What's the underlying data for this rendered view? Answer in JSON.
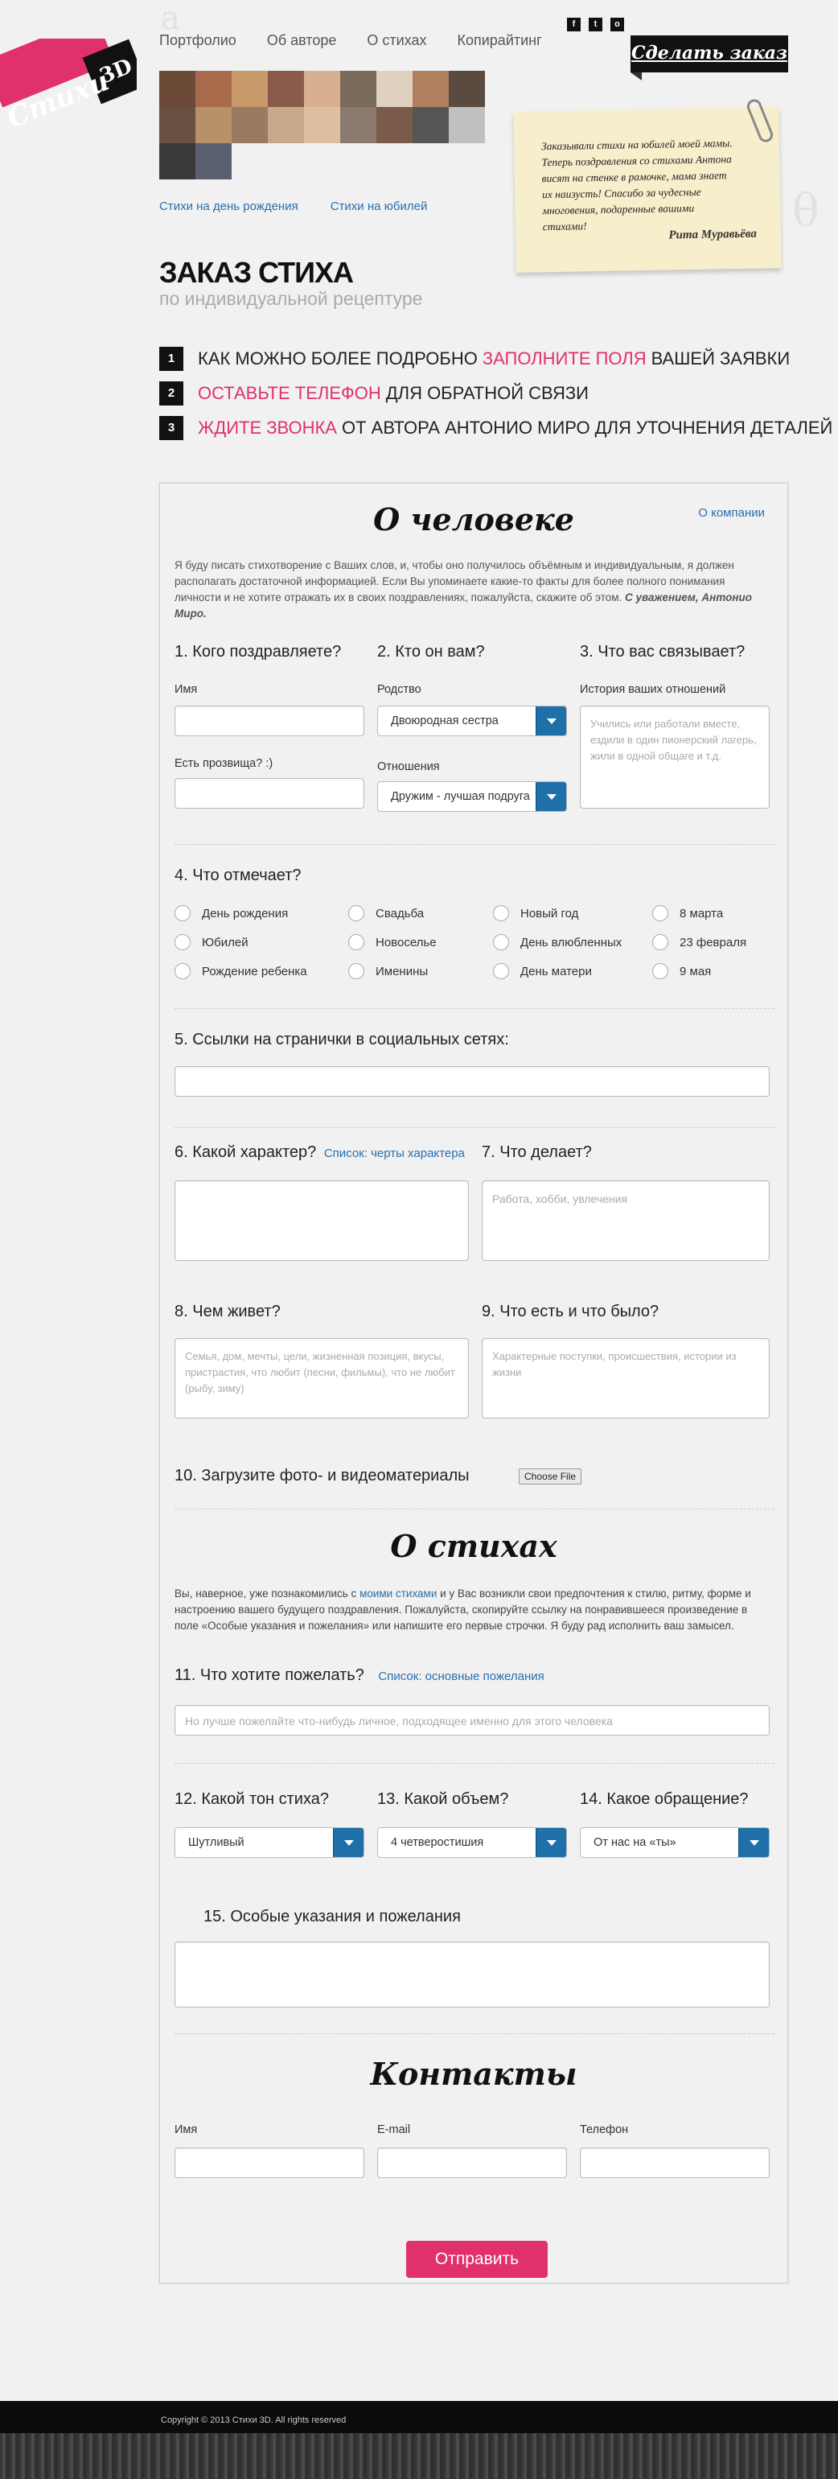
{
  "nav": {
    "items": [
      "Портфолио",
      "Об авторе",
      "О стихах",
      "Копирайтинг"
    ]
  },
  "logo": {
    "text1": "Стихи",
    "text2": "3D"
  },
  "social": [
    "f",
    "t",
    "o"
  ],
  "order_button": "Сделать заказ",
  "sublinks": [
    "Стихи на день рождения",
    "Стихи на юбилей"
  ],
  "testimonial": {
    "text": "Заказывали стихи на юбилей моей мамы. Теперь поздравления со стихами Антона висят на стенке в рамочке, мама знает их наизусть! Спасибо за чудесные многовения, подаренные вашими стихами!",
    "author": "Рита Муравьёва"
  },
  "page": {
    "title": "ЗАКАЗ СТИХА",
    "subtitle": "по индивидуальной рецептуре"
  },
  "steps": [
    {
      "num": "1",
      "pre": "Как можно более подробно",
      "hl": "заполните поля",
      "post": "вашей заявки"
    },
    {
      "num": "2",
      "pre": "",
      "hl": "Оставьте телефон",
      "post": "для обратной связи"
    },
    {
      "num": "3",
      "pre": "",
      "hl": "Ждите звонка",
      "post": "от автора Антонио Миро для уточнения деталей"
    }
  ],
  "form": {
    "sec1_title": "О человеке",
    "company_link": "О компании",
    "intro1": "Я буду писать стихотворение с Ваших слов, и, чтобы оно получилось объёмным и индивидуальным, я должен располагать достаточной информацией. Если Вы упоминаете какие-то факты для более полного понимания личности и не хотите отражать их в своих поздравлениях, пожалуйста, скажите об этом.",
    "intro1_sign": "С уважением, Антонио Миро.",
    "q1": "1. Кого поздравляете?",
    "q2": "2. Кто он вам?",
    "q3": "3. Что вас связывает?",
    "name_label": "Имя",
    "nick_label": "Есть прозвища? :)",
    "kin_label": "Родство",
    "kin_value": "Двоюродная сестра",
    "rel_label": "Отношения",
    "rel_value": "Дружим - лучшая подруга",
    "hist_label": "История ваших отношений",
    "hist_placeholder": "Учились или работали вместе, ездили в один пионерский лагерь, жили в одной общаге и т.д.",
    "q4": "4. Что отмечает?",
    "events": [
      "День рождения",
      "Свадьба",
      "Новый год",
      "8 марта",
      "Юбилей",
      "Новоселье",
      "День влюбленных",
      "23 февраля",
      "Рождение ребенка",
      "Именины",
      "День матери",
      "9 мая"
    ],
    "q5": "5. Ссылки на странички в социальных сетях:",
    "q6": "6. Какой характер?",
    "q6_link": "Список: черты характера",
    "q7": "7. Что делает?",
    "q7_placeholder": "Работа, хобби, увлечения",
    "q8": "8. Чем живет?",
    "q8_placeholder": "Семья, дом, мечты, цели, жизненная позиция, вкусы, пристрастия, что любит (песни, фильмы), что не любит (рыбу, зиму)",
    "q9": "9. Что есть и что было?",
    "q9_placeholder": "Характерные поступки, происшествия, истории из жизни",
    "q10": "10. Загрузите фото- и видеоматериалы",
    "file_btn": "Choose File",
    "sec2_title": "О стихах",
    "intro2_a": "Вы, наверное, уже познакомились с",
    "intro2_link": "моими стихами",
    "intro2_b": "и у Вас возникли свои предпочтения к стилю, ритму, форме и настроению вашего будущего поздравления. Пожалуйста, скопируйте ссылку на понравившееся произведение в поле «Особые указания и пожелания» или напишите его первые строчки. Я буду рад исполнить ваш замысел.",
    "q11": "11. Что хотите пожелать?",
    "q11_link": "Список: основные пожелания",
    "q11_placeholder": "Но лучше пожелайте что-нибудь личное, подходящее именно для этого человека",
    "q12": "12. Какой тон стиха?",
    "q12_value": "Шутливый",
    "q13": "13. Какой объем?",
    "q13_value": "4 четверостишия",
    "q14": "14. Какое обращение?",
    "q14_value": "От нас на «ты»",
    "q15": "15. Особые указания и пожелания",
    "sec3_title": "Контакты",
    "c_name": "Имя",
    "c_email": "E-mail",
    "c_phone": "Телефон",
    "submit": "Отправить"
  },
  "footer": {
    "copyright": "Copyright © 2013 Стихи 3D. All rights reserved"
  },
  "colors": {
    "accent": "#e0306d",
    "link": "#2a6fae",
    "select_btn": "#1f6fa8"
  }
}
